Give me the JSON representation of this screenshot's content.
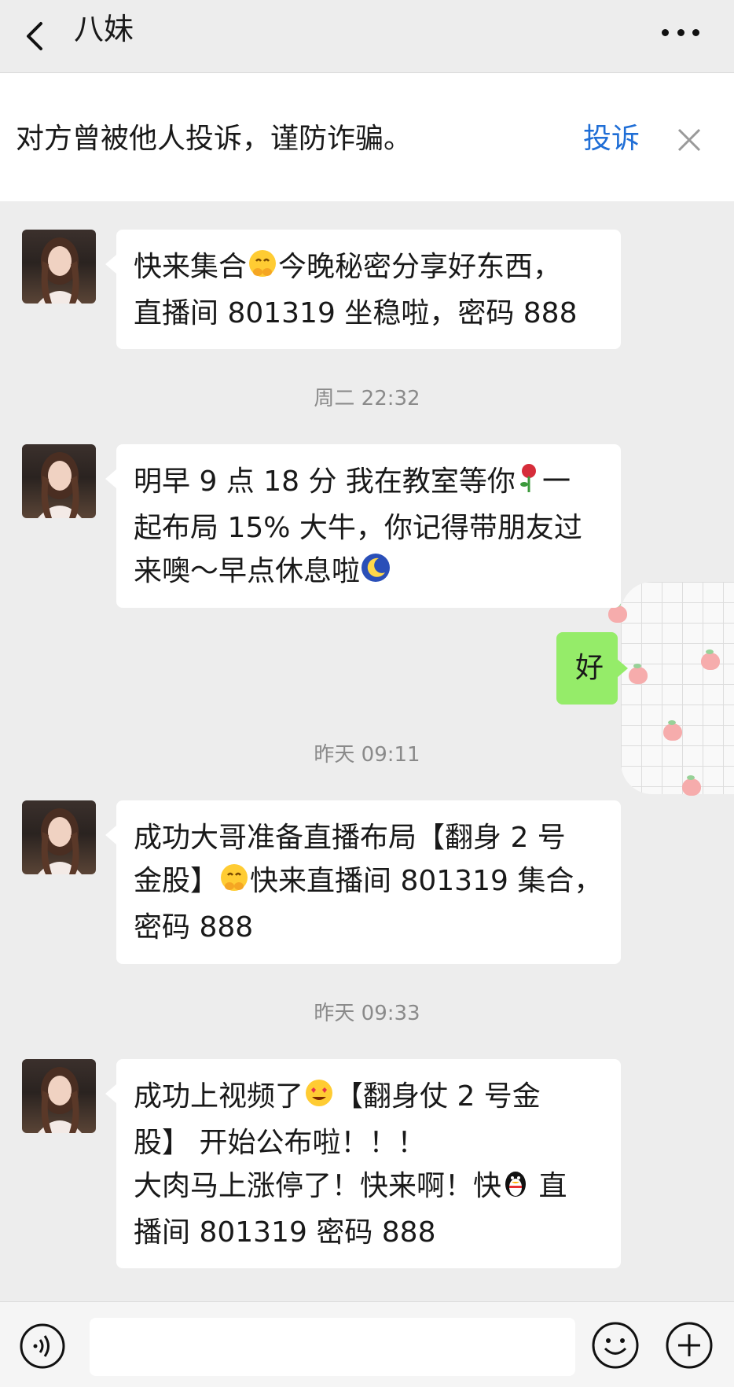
{
  "header": {
    "title": "八妹",
    "back_icon": "chevron-left-icon",
    "more_icon": "more-dots-icon"
  },
  "warning": {
    "text": "对方曾被他人投诉，谨防诈骗。",
    "complain_label": "投诉",
    "close_icon": "close-icon"
  },
  "messages": {
    "m1": {
      "part1": "快来集合",
      "emoji1": "hugging-face",
      "part2": "今晚秘密分享好东西，\n直播间 801319 坐稳啦，密码 888"
    },
    "ts1": "周二 22:32",
    "m2": {
      "part1": "明早 9 点 18 分 我在教室等你",
      "emoji1": "rose",
      "part2": "一\n起布局 15% 大牛，你记得带朋友过\n来噢～早点休息啦",
      "emoji2": "moon-night"
    },
    "mine1": "好",
    "ts2": "昨天 09:11",
    "m3": {
      "part1": "成功大哥准备直播布局【翻身 2 号\n金股】",
      "emoji1": "hugging-face",
      "part2": "快来直播间 801319 集合，\n密码 888"
    },
    "ts3": "昨天 09:33",
    "m4": {
      "part1": "成功上视频了",
      "emoji1": "heart-eyes",
      "part2": "【翻身仗 2 号金\n股】 开始公布啦！！！\n大肉马上涨停了！快来啊！快",
      "emoji2": "qq-penguin",
      "part3": " 直\n播间 801319 密码 888"
    }
  },
  "input_bar": {
    "voice_icon": "voice-icon",
    "emoji_icon": "emoji-face-icon",
    "plus_icon": "plus-icon"
  },
  "colors": {
    "background": "#ededed",
    "bubble_other": "#ffffff",
    "bubble_mine": "#95ec69",
    "link": "#1f6ed6"
  }
}
